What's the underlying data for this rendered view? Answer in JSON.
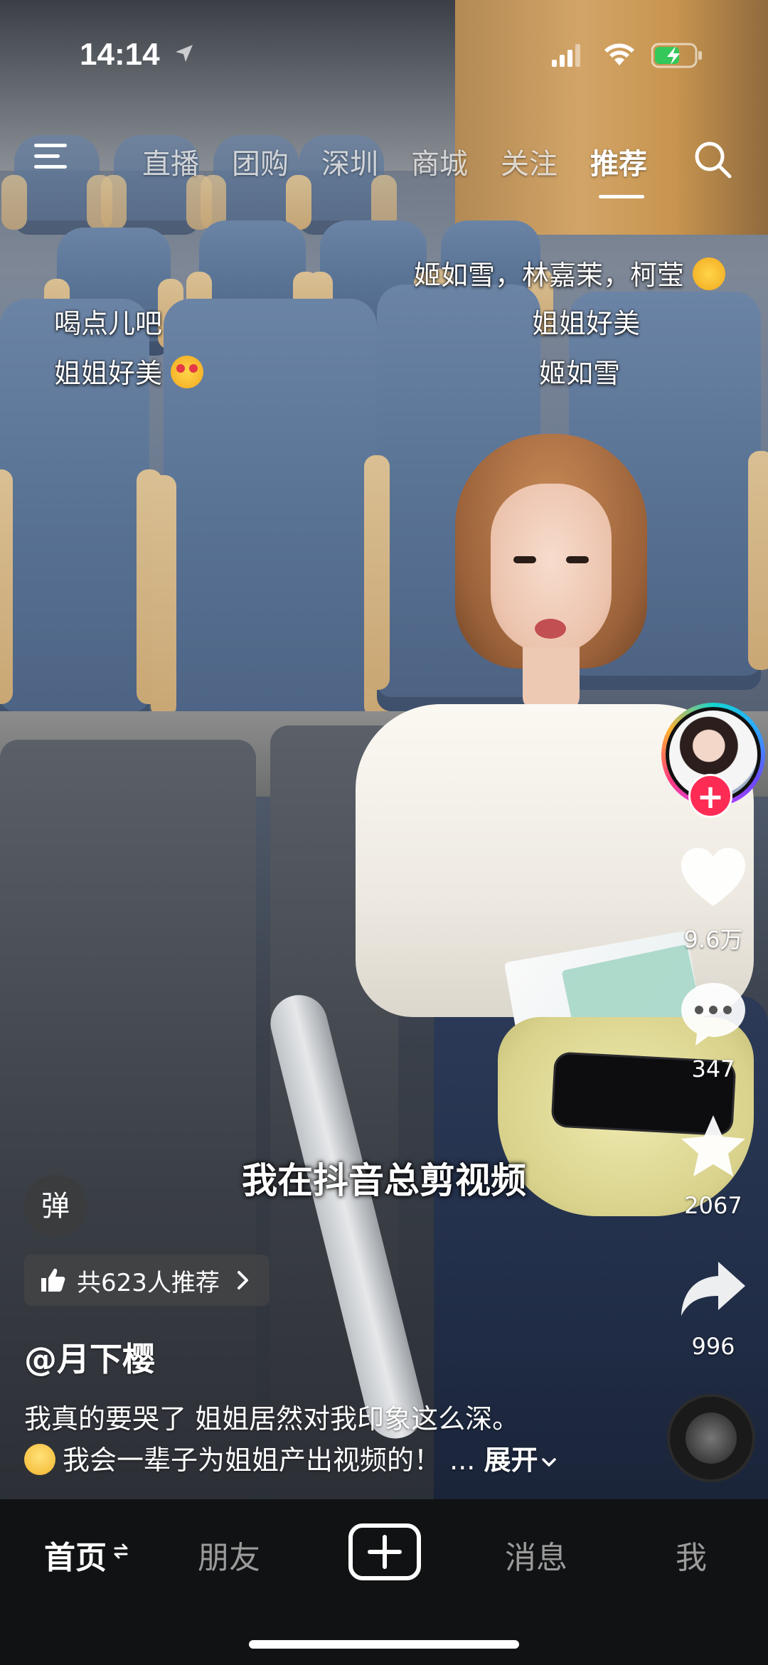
{
  "status_bar": {
    "time": "14:14"
  },
  "top_tabs": [
    {
      "label": "直播"
    },
    {
      "label": "团购"
    },
    {
      "label": "深圳"
    },
    {
      "label": "商城"
    },
    {
      "label": "关注"
    },
    {
      "label": "推荐",
      "active": true
    }
  ],
  "danmaku": [
    "姬如雪，林嘉茉，柯莹",
    "喝点儿吧",
    "姐姐好美",
    "姐姐好美",
    "姐姐好美",
    "姬如雪"
  ],
  "video": {
    "subtitle": "我在抖音总剪视频"
  },
  "actions": {
    "likes": "9.6万",
    "comments": "347",
    "favorites": "2067",
    "shares": "996"
  },
  "danmaku_toggle": "弹",
  "recommend": {
    "label": "共623人推荐"
  },
  "author": "@月下樱",
  "description": {
    "line1": "我真的要哭了 姐姐居然对我印象这么深。",
    "line2": "我会一辈子为姐姐产出视频的！",
    "ellipsis": "...",
    "more": "展开"
  },
  "bottom_nav": {
    "home": "首页",
    "friends": "朋友",
    "messages": "消息",
    "me": "我"
  },
  "colors": {
    "accent": "#fe2c55",
    "nav_bg": "#111213"
  }
}
